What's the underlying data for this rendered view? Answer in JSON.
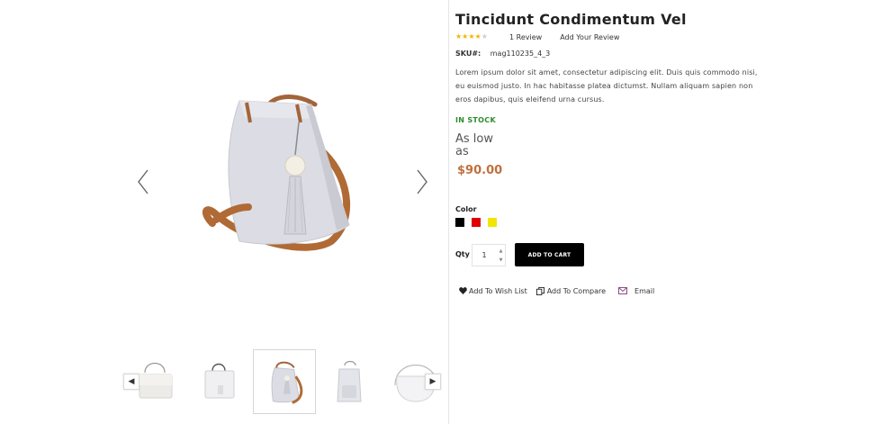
{
  "product": {
    "title": "Tincidunt Condimentum Vel",
    "rating_stars": 4,
    "rating_max": 5,
    "review_count_label": "1 Review",
    "add_review_label": "Add Your Review",
    "sku_label": "SKU#:",
    "sku_value": "mag110235_4_3",
    "description": "Lorem ipsum dolor sit amet, consectetur adipiscing elit. Duis quis commodo nisi, eu euismod justo. In hac habitasse platea dictumst. Nullam aliquam sapien non eros dapibus, quis eleifend urna cursus.",
    "stock_status": "IN STOCK",
    "price_prefix": "As low as",
    "price": "$90.00"
  },
  "options": {
    "color_label": "Color",
    "colors": [
      "#000000",
      "#e00000",
      "#f2e600"
    ]
  },
  "cart": {
    "qty_label": "Qty",
    "qty_value": "1",
    "add_to_cart_label": "ADD TO CART"
  },
  "actions": {
    "wishlist_label": "Add To Wish List",
    "compare_label": "Add To Compare",
    "email_label": "Email"
  },
  "gallery": {
    "thumbnails": [
      "flap-handbag",
      "box-handbag",
      "bucket-bag",
      "mini-backpack",
      "round-shoulder-bag"
    ],
    "active_index": 2
  },
  "colors": {
    "price": "#c0703e",
    "in_stock": "#2e8b2e",
    "star": "#f4b400",
    "button_bg": "#000000"
  }
}
